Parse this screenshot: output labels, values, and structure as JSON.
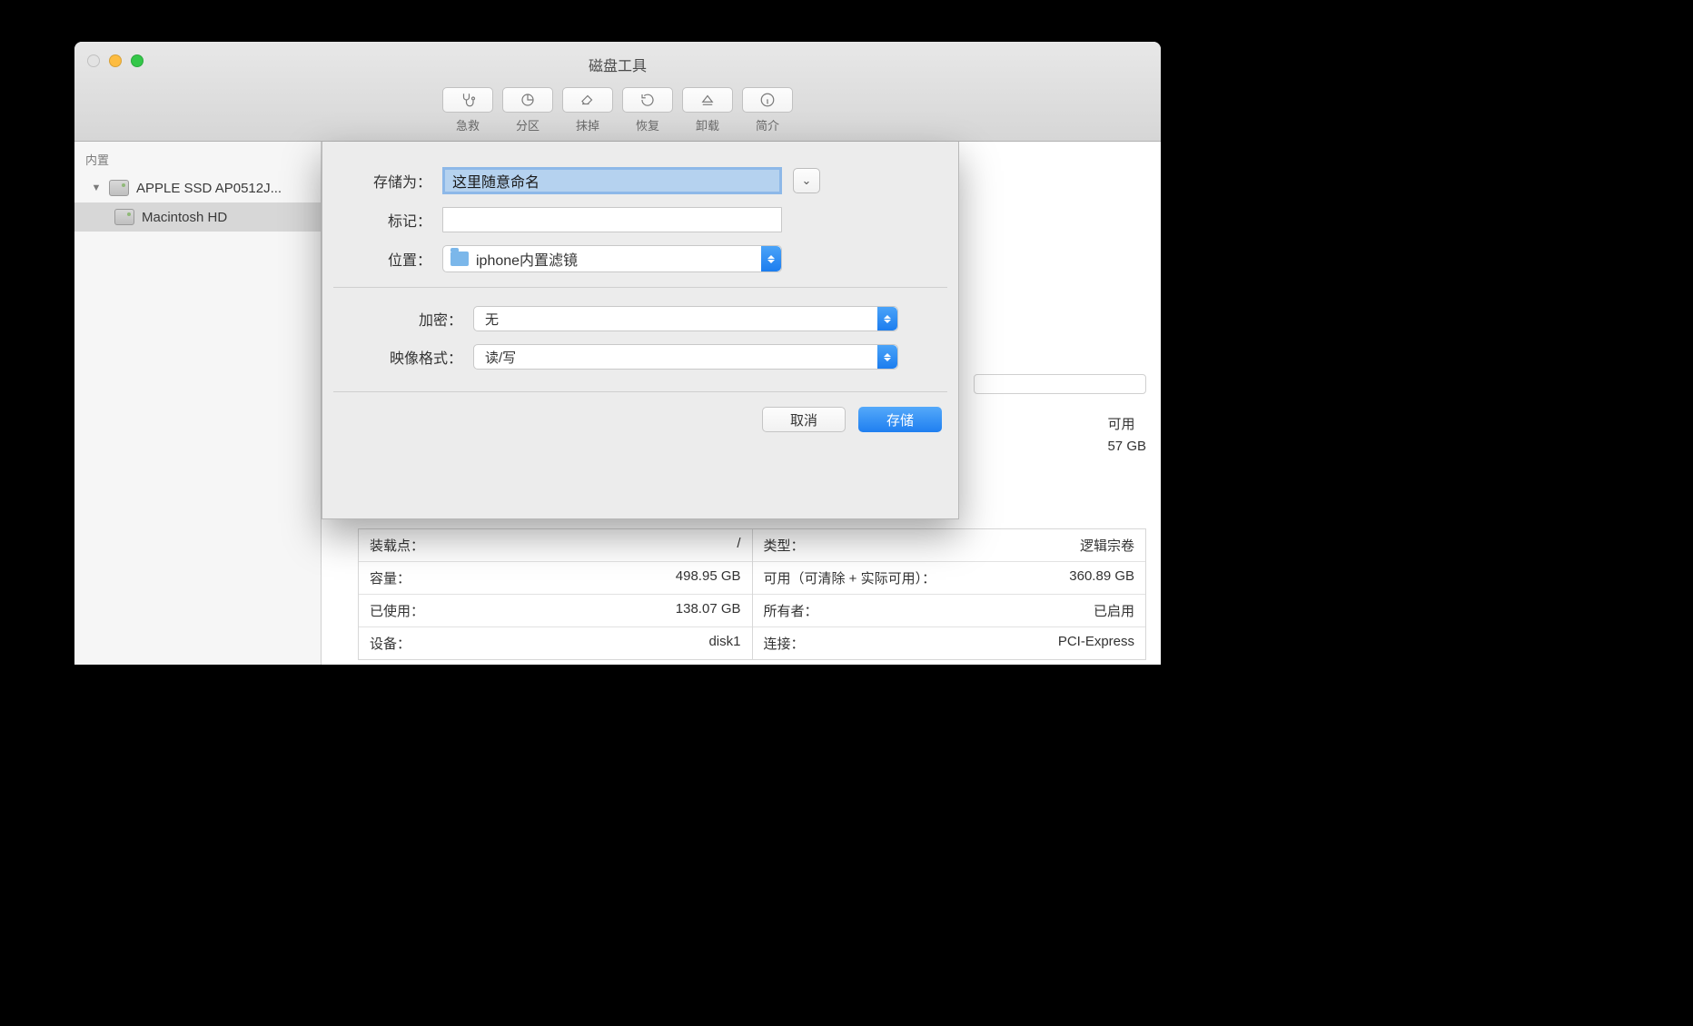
{
  "window": {
    "title": "磁盘工具"
  },
  "toolbar": [
    {
      "label": "急救"
    },
    {
      "label": "分区"
    },
    {
      "label": "抹掉"
    },
    {
      "label": "恢复"
    },
    {
      "label": "卸载"
    },
    {
      "label": "简介"
    }
  ],
  "sidebar": {
    "section": "内置",
    "parent": "APPLE SSD AP0512J...",
    "child": "Macintosh HD"
  },
  "main": {
    "available_label": "可用",
    "available_value": "57 GB",
    "info_left": [
      {
        "k": "装载点：",
        "v": "/"
      },
      {
        "k": "容量：",
        "v": "498.95 GB"
      },
      {
        "k": "已使用：",
        "v": "138.07 GB"
      },
      {
        "k": "设备：",
        "v": "disk1"
      }
    ],
    "info_right": [
      {
        "k": "类型：",
        "v": "逻辑宗卷"
      },
      {
        "k": "可用（可清除 + 实际可用）：",
        "v": "360.89 GB"
      },
      {
        "k": "所有者：",
        "v": "已启用"
      },
      {
        "k": "连接：",
        "v": "PCI-Express"
      }
    ]
  },
  "sheet": {
    "save_as_label": "存储为：",
    "save_as_value": "这里随意命名",
    "tags_label": "标记：",
    "location_label": "位置：",
    "location_value": "iphone内置滤镜",
    "encrypt_label": "加密：",
    "encrypt_value": "无",
    "format_label": "映像格式：",
    "format_value": "读/写",
    "cancel": "取消",
    "save": "存储"
  }
}
